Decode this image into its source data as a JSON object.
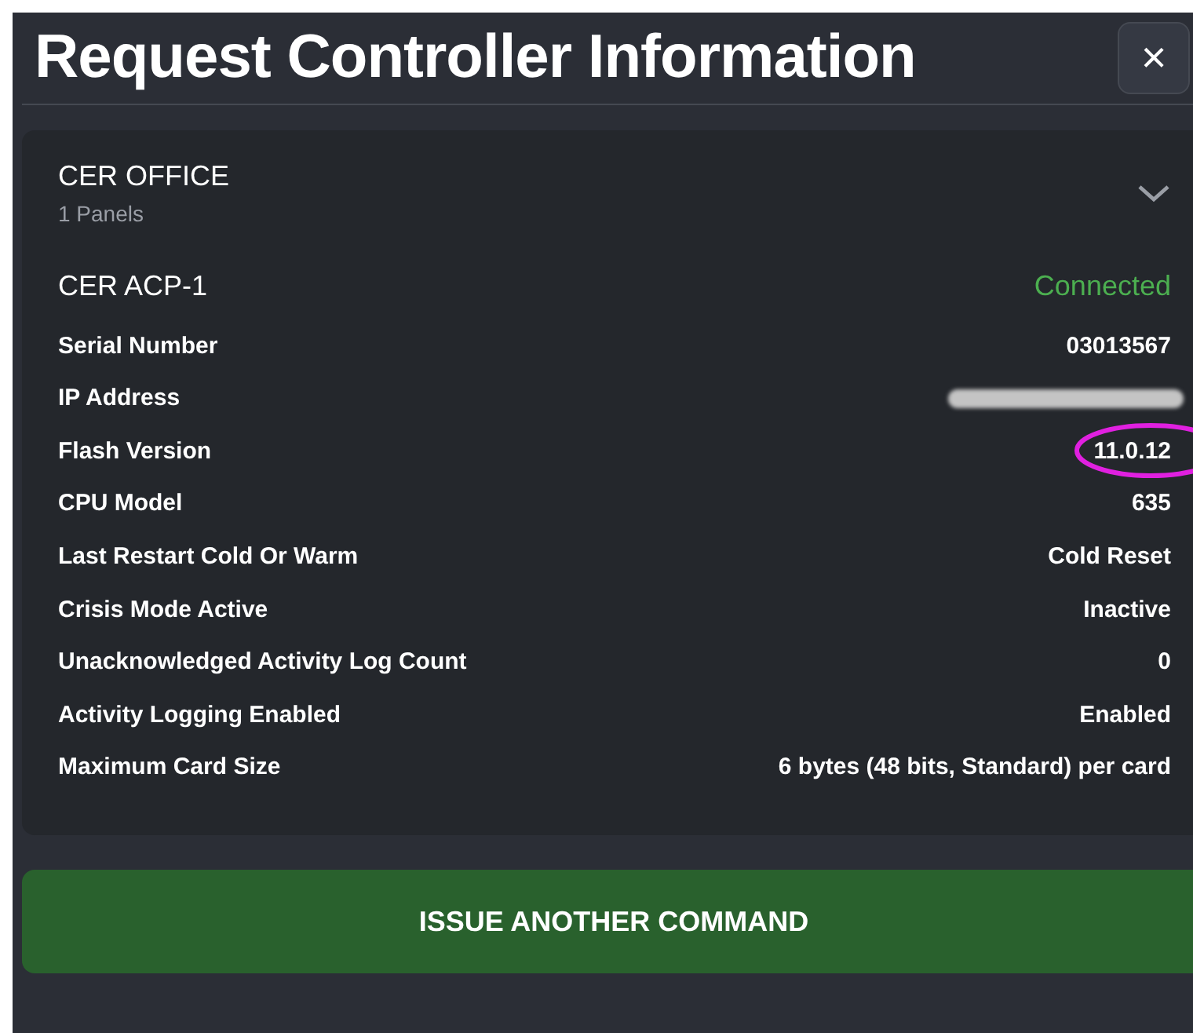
{
  "dialog": {
    "title": "Request Controller Information",
    "close": "×"
  },
  "site": {
    "name": "CER OFFICE",
    "subtitle": "1 Panels",
    "expanded": true
  },
  "controller": {
    "name": "CER ACP-1",
    "status": "Connected",
    "connected": true
  },
  "details": [
    {
      "label": "Serial Number",
      "value": "03013567",
      "redacted": false,
      "circled": false
    },
    {
      "label": "IP Address",
      "redacted": true,
      "circled": false
    },
    {
      "label": "Flash Version",
      "value": "11.0.12",
      "redacted": false,
      "circled": true
    },
    {
      "label": "CPU Model",
      "value": "635",
      "redacted": false,
      "circled": false
    },
    {
      "label": "Last Restart Cold Or Warm",
      "value": "Cold Reset",
      "redacted": false,
      "circled": false
    },
    {
      "label": "Crisis Mode Active",
      "value": "Inactive",
      "redacted": false,
      "circled": false
    },
    {
      "label": "Unacknowledged Activity Log Count",
      "value": "0",
      "redacted": false,
      "circled": false
    },
    {
      "label": "Activity Logging Enabled",
      "value": "Enabled",
      "redacted": false,
      "circled": false
    },
    {
      "label": "Maximum Card Size",
      "value": "6 bytes (48 bits, Standard) per card",
      "redacted": false,
      "circled": false
    }
  ],
  "action_button": "ISSUE ANOTHER COMMAND"
}
